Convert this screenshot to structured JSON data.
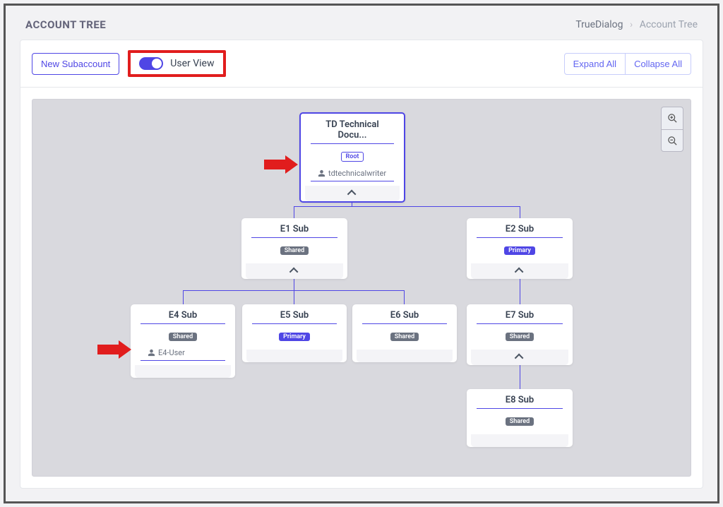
{
  "header": {
    "title": "ACCOUNT TREE",
    "breadcrumb": {
      "parent": "TrueDialog",
      "current": "Account Tree"
    }
  },
  "toolbar": {
    "new_subaccount": "New Subaccount",
    "user_view_label": "User View",
    "expand_all": "Expand All",
    "collapse_all": "Collapse All"
  },
  "tree": {
    "root": {
      "title": "TD Technical Docu...",
      "badge": "Root",
      "user": "tdtechnicalwriter"
    },
    "level2": [
      {
        "title": "E1 Sub",
        "badge": "Shared"
      },
      {
        "title": "E2 Sub",
        "badge": "Primary"
      }
    ],
    "level3": [
      {
        "title": "E4 Sub",
        "badge": "Shared",
        "user": "E4-User"
      },
      {
        "title": "E5 Sub",
        "badge": "Primary"
      },
      {
        "title": "E6 Sub",
        "badge": "Shared"
      },
      {
        "title": "E7 Sub",
        "badge": "Shared"
      }
    ],
    "level4": [
      {
        "title": "E8 Sub",
        "badge": "Shared"
      }
    ]
  }
}
